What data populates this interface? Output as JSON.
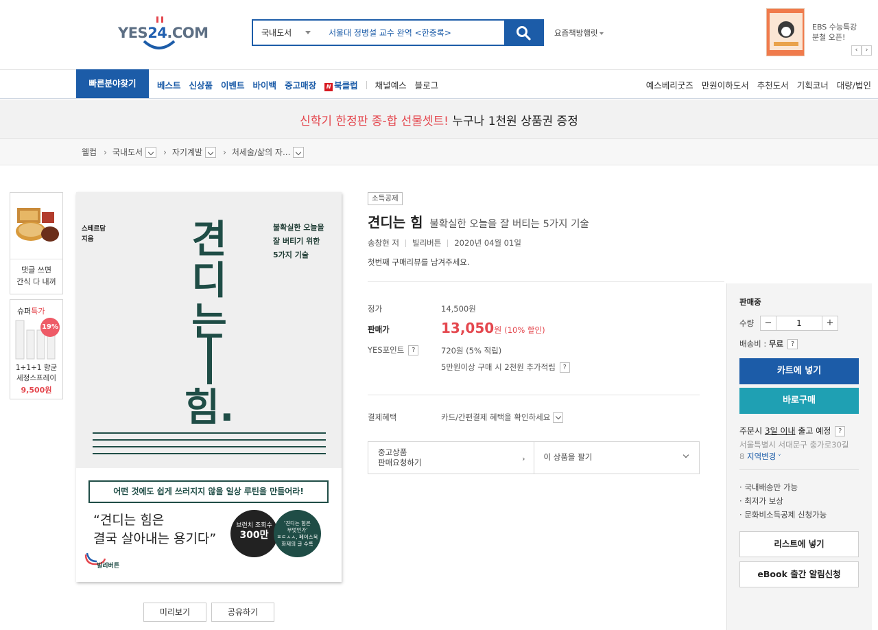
{
  "header": {
    "logo_text": "YES24.COM",
    "search_category": "국내도서",
    "search_placeholder": "서울대 정병설 교수 완역 <한중록>",
    "hot_books": "요즘책방햄릿",
    "ebs_promo_line1": "EBS 수능특강",
    "ebs_promo_line2": "분철 오픈!"
  },
  "gnb": {
    "quick": "빠른분야찾기",
    "left_items": [
      "베스트",
      "신상품",
      "이벤트",
      "바이백",
      "중고매장"
    ],
    "bookclub": "북클럽",
    "bookclub_badge": "N",
    "dark_items": [
      "채널예스",
      "블로그"
    ],
    "right_items": [
      "예스베리굿즈",
      "만원이하도서",
      "추천도서",
      "기획코너",
      "대량/법인"
    ]
  },
  "banner": {
    "red_text": "신학기 한정판 종-합 선물셋트!",
    "text": " 누구나 1천원 상품권 증정"
  },
  "breadcrumb": {
    "home": "웰컴",
    "items": [
      "국내도서",
      "자기계발",
      "처세술/삶의 자..."
    ]
  },
  "side_ads": {
    "ad1_text_1": "댓글 쓰면",
    "ad1_text_2": "간식 다 내꺼",
    "ad2_title_a": "슈퍼",
    "ad2_title_b": "특가",
    "ad2_discount": "19%",
    "ad2_name_1": "1+1+1 향균",
    "ad2_name_2": "세정스프레이",
    "ad2_price": "9,500원"
  },
  "cover": {
    "publisher_top": "스테르담",
    "author_top": "지음",
    "sub1": "불확실한 오늘을",
    "sub2": "잘 버티기 위한",
    "sub3": "5가지 기술",
    "big1": "견",
    "big2": "디",
    "big3": "는",
    "big4": "힘.",
    "tagline": "어떤 것에도 쉽게 쓰러지지 않을 일상 루틴을 만들어라!",
    "quote1": "“견디는 힘은",
    "quote2": "결국 살아내는 용기다”",
    "circle1_a": "브런치 조회수",
    "circle1_b": "300만",
    "circle2_a": "'견디는 힘은",
    "circle2_b": "무엇인가'",
    "circle2_c": "ㅍㅌㅅㅅ, 페이스북",
    "circle2_d": "화제의 글 수록",
    "logo": "빌리버튼"
  },
  "preview_buttons": [
    "미리보기",
    "공유하기"
  ],
  "product": {
    "tax_badge": "소득공제",
    "title": "견디는 힘",
    "subtitle": "불확실한 오늘을 잘 버티는 5가지 기술",
    "author": "송창현 저",
    "publisher": "빌리버튼",
    "date": "2020년 04월 01일",
    "review_cta": "첫번째 구매리뷰를 남겨주세요.",
    "list_price_label": "정가",
    "list_price": "14,500원",
    "sale_label": "판매가",
    "sale_price": "13,050",
    "sale_unit": "원",
    "sale_discount": "(10% 할인)",
    "point_label": "YES포인트",
    "point_value": "720원 (5% 적립)",
    "point_extra": "5만원이상 구매 시 2천원 추가적립",
    "payment_label": "결제혜택",
    "payment_value": "카드/간편결제 혜택을 확인하세요",
    "used_1": "중고상품",
    "used_2": "판매요청하기",
    "sell": "이 상품을 팔기"
  },
  "panel": {
    "status": "판매중",
    "qty_label": "수량",
    "qty_value": "1",
    "shipping_label": "배송비 :",
    "shipping_value": "무료",
    "cart": "카트에 넣기",
    "buy": "바로구매",
    "delivery_a": "주문시 ",
    "delivery_b": "3일 이내",
    "delivery_c": " 출고 예정",
    "address_1": "서울특별시 서대문구 충가로30길",
    "address_2": "8",
    "address_change": "지역변경",
    "bullets": [
      "국내배송만 가능",
      "최저가 보상",
      "문화비소득공제 신청가능"
    ],
    "list_button": "리스트에 넣기",
    "ebook_button": "eBook 출간 알림신청"
  }
}
